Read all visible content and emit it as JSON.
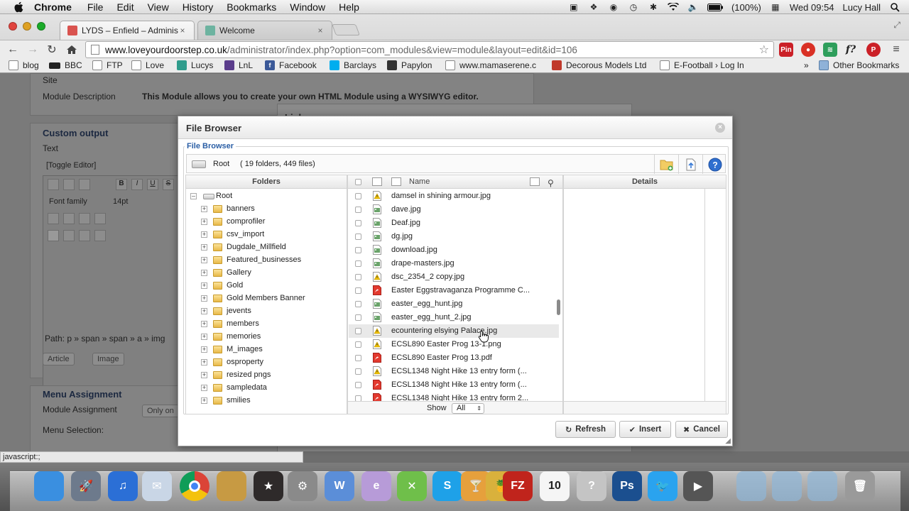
{
  "menubar": {
    "app": "Chrome",
    "items": [
      "File",
      "Edit",
      "View",
      "History",
      "Bookmarks",
      "Window",
      "Help"
    ],
    "battery": "(100%)",
    "clock": "Wed 09:54",
    "user": "Lucy Hall"
  },
  "tabs": [
    {
      "title": "LYDS – Enfield – Administ",
      "close": "×",
      "color": "#d9534f"
    },
    {
      "title": "Welcome",
      "close": "×",
      "color": "#6db3a0"
    }
  ],
  "address": {
    "host": "www.loveyourdoorstep.co.uk",
    "path": "/administrator/index.php?option=com_modules&view=module&layout=edit&id=106"
  },
  "extensions": [
    {
      "label": "Pin",
      "color": "#cb2027"
    },
    {
      "label": "●",
      "color": "#d93025"
    },
    {
      "label": "≋",
      "color": "#2e9e5b"
    },
    {
      "label": "f?",
      "color": "#ececec"
    },
    {
      "label": "P",
      "color": "#cb2027"
    }
  ],
  "bookmarks": [
    {
      "label": "blog",
      "icon": "page-icon",
      "color": "#ffffff"
    },
    {
      "label": "BBC",
      "icon": "bbc-icon",
      "color": "#222222"
    },
    {
      "label": "FTP",
      "icon": "page-icon",
      "color": "#ffffff"
    },
    {
      "label": "Love",
      "icon": "page-icon",
      "color": "#ffffff"
    },
    {
      "label": "Lucys",
      "icon": "lucys-icon",
      "color": "#2f9c8c"
    },
    {
      "label": "LnL",
      "icon": "lnl-icon",
      "color": "#5b3d8c"
    },
    {
      "label": "Facebook",
      "icon": "facebook-icon",
      "color": "#3b5998"
    },
    {
      "label": "Barclays",
      "icon": "barclays-icon",
      "color": "#00aeef"
    },
    {
      "label": "Papylon",
      "icon": "papylon-icon",
      "color": "#333333"
    },
    {
      "label": "www.mamaserene.c",
      "icon": "page-icon",
      "color": "#ffffff"
    },
    {
      "label": "Decorous Models Ltd",
      "icon": "decorous-icon",
      "color": "#c0392b"
    },
    {
      "label": "E-Football › Log In",
      "icon": "page-icon",
      "color": "#ffffff"
    }
  ],
  "bookmarks_more": "»",
  "bookmarks_other": "Other Bookmarks",
  "page": {
    "site_label": "Site",
    "module_description_label": "Module Description",
    "module_description": "This Module allows you to create your own HTML Module using a WYSIWYG editor.",
    "custom_output": "Custom output",
    "text_label": "Text",
    "toggle_editor": "[Toggle Editor]",
    "font_family": "Font family",
    "font_size": "14pt",
    "path": "Path:  p » span » span » a » img",
    "article_btn": "Article",
    "image_btn": "Image",
    "menu_assignment": "Menu Assignment",
    "module_assignment_label": "Module Assignment",
    "module_assignment_value": "Only on",
    "menu_selection": "Menu Selection:",
    "link_title": "Link"
  },
  "file_browser": {
    "title": "File Browser",
    "legend": "File Browser",
    "root": "Root",
    "summary": "( 19 folders, 449 files)",
    "columns": {
      "folders": "Folders",
      "name": "Name",
      "details": "Details"
    },
    "tree_root": "Root",
    "folders": [
      "banners",
      "comprofiler",
      "csv_import",
      "Dugdale_Millfield",
      "Featured_businesses",
      "Gallery",
      "Gold",
      "Gold Members Banner",
      "jevents",
      "members",
      "memories",
      "M_images",
      "osproperty",
      "resized pngs",
      "sampledata",
      "smilies"
    ],
    "files": [
      {
        "name": "damsel in shining armour.jpg",
        "type": "warning"
      },
      {
        "name": "dave.jpg",
        "type": "image"
      },
      {
        "name": "Deaf.jpg",
        "type": "image"
      },
      {
        "name": "dg.jpg",
        "type": "image"
      },
      {
        "name": "download.jpg",
        "type": "image"
      },
      {
        "name": "drape-masters.jpg",
        "type": "image"
      },
      {
        "name": "dsc_2354_2 copy.jpg",
        "type": "warning"
      },
      {
        "name": "Easter Eggstravaganza Programme C...",
        "type": "pdf"
      },
      {
        "name": "easter_egg_hunt.jpg",
        "type": "image"
      },
      {
        "name": "easter_egg_hunt_2.jpg",
        "type": "image"
      },
      {
        "name": "ecountering elsying Palace.jpg",
        "type": "warning"
      },
      {
        "name": "ECSL890 Easter Prog 13-1.png",
        "type": "warning"
      },
      {
        "name": "ECSL890 Easter Prog 13.pdf",
        "type": "pdf"
      },
      {
        "name": "ECSL1348 Night Hike 13 entry form (...",
        "type": "warning"
      },
      {
        "name": "ECSL1348 Night Hike 13 entry form (...",
        "type": "pdf"
      },
      {
        "name": "ECSL1348 Night Hike 13 entry form 2...",
        "type": "pdf"
      }
    ],
    "show_label": "Show",
    "show_value": "All",
    "refresh": "Refresh",
    "insert": "Insert",
    "cancel": "Cancel"
  },
  "status_url": "javascript:;",
  "dock_apps": [
    "finder-icon",
    "launchpad-icon",
    "itunes-icon",
    "mail-icon",
    "chrome-icon",
    "iphoto-icon",
    "imovie-icon",
    "system-preferences-icon",
    "word-icon",
    "elegant-icon",
    "xcode-icon",
    "skype-icon",
    "drink-icon",
    "pineapple-icon",
    "filezilla-icon",
    "calendar-icon",
    "help-icon",
    "photoshop-icon",
    "twitter-icon",
    "video-icon",
    "folder-icon",
    "applications-icon",
    "documents-icon",
    "trash-icon"
  ],
  "calendar_day": "10",
  "photoshop_label": "Ps",
  "filezilla_label": "FZ"
}
